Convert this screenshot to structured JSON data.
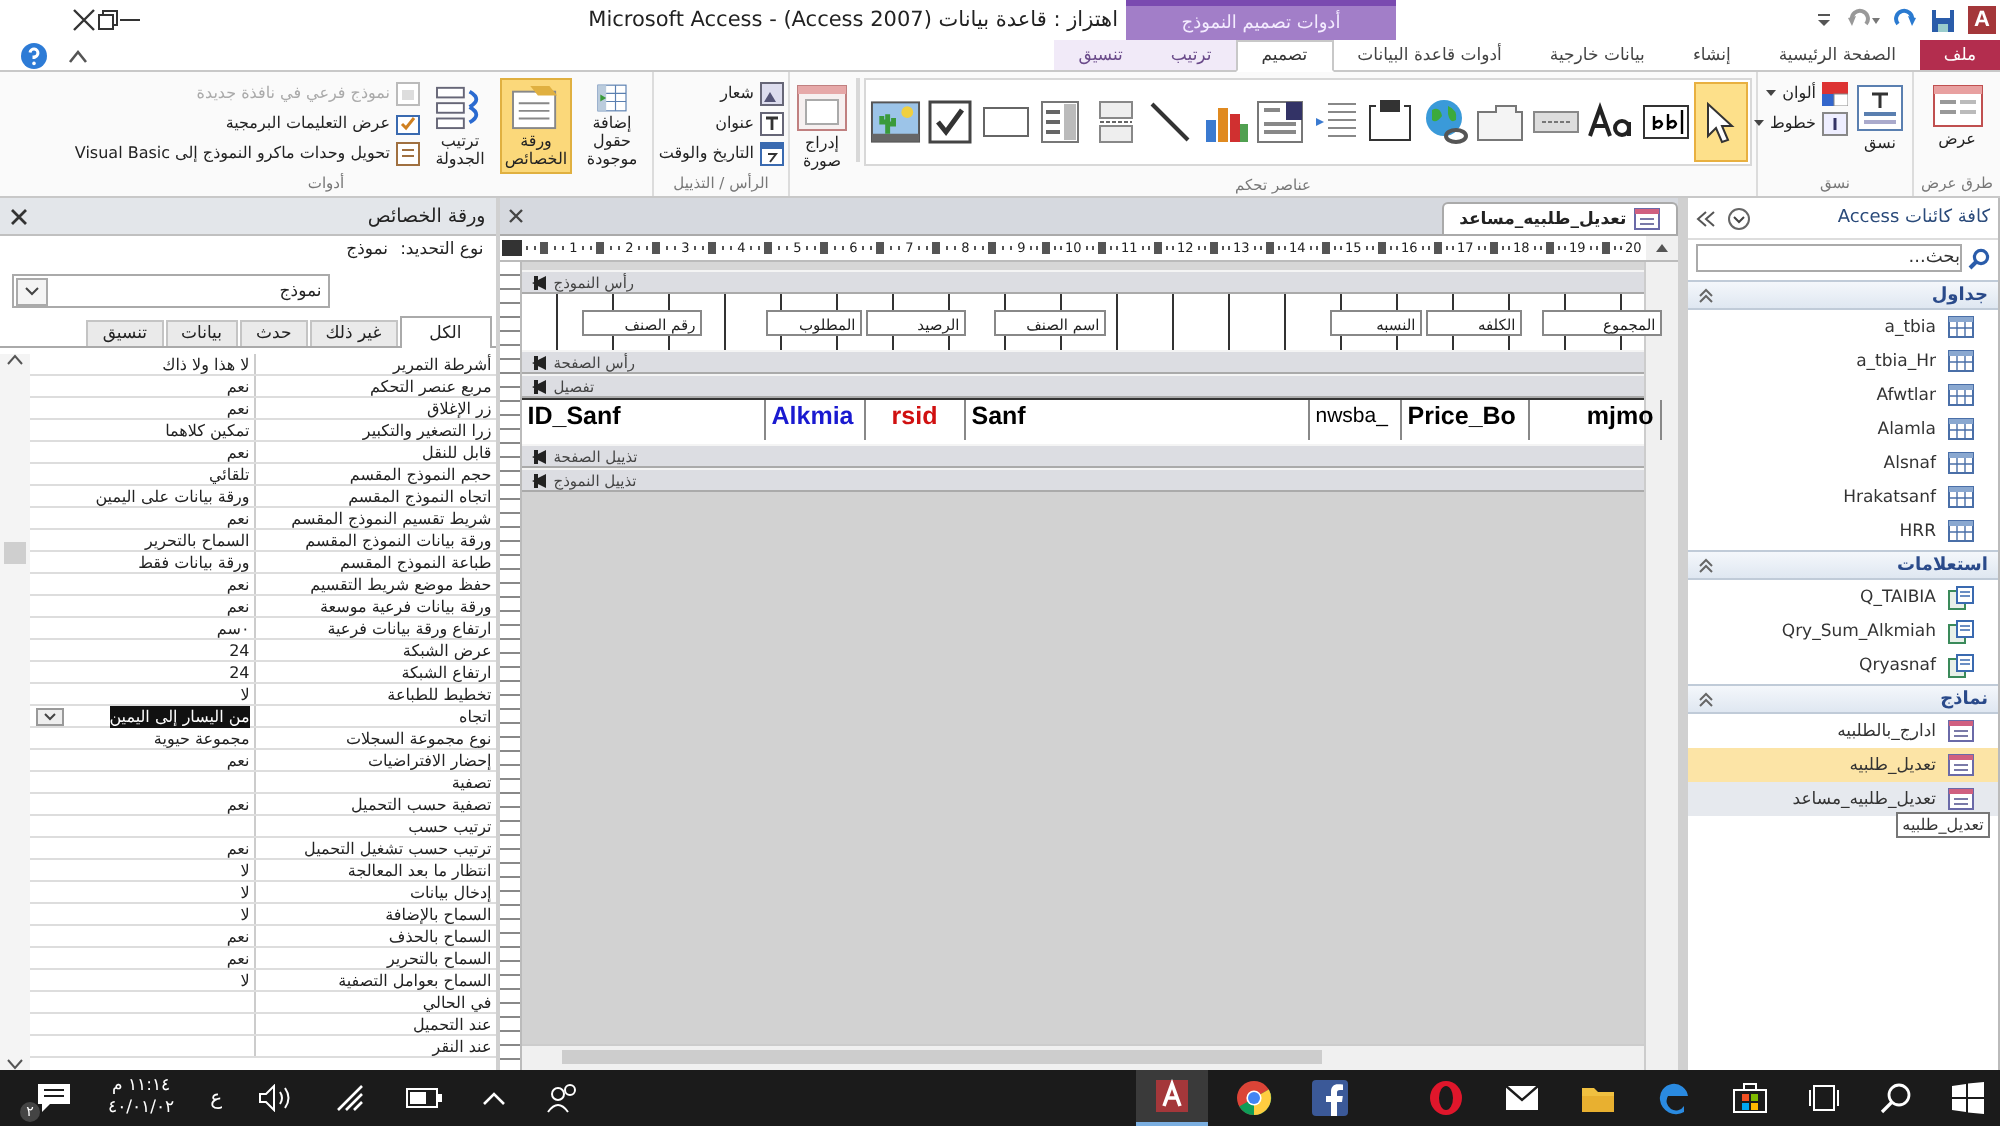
{
  "title_bar": {
    "logo": "A",
    "title": "اهتزاز : قاعدة بيانات (Access 2007) - Microsoft Access",
    "context_group": "أدوات تصميم النموذج"
  },
  "ribbon_tabs": [
    {
      "label": "ملف",
      "kind": "file",
      "selected": false
    },
    {
      "label": "الصفحة الرئيسية",
      "kind": "normal",
      "selected": false
    },
    {
      "label": "إنشاء",
      "kind": "normal",
      "selected": false
    },
    {
      "label": "بيانات خارجية",
      "kind": "normal",
      "selected": false
    },
    {
      "label": "أدوات قاعدة البيانات",
      "kind": "normal",
      "selected": false
    },
    {
      "label": "تصميم",
      "kind": "contextual",
      "selected": true
    },
    {
      "label": "ترتيب",
      "kind": "contextual",
      "selected": false
    },
    {
      "label": "تنسيق",
      "kind": "contextual",
      "selected": false
    }
  ],
  "views_group": {
    "label": "طرق عرض",
    "view_button": "عرض"
  },
  "themes_group": {
    "label": "نسق",
    "themes_button": "نسق",
    "colors_button": "ألوان",
    "fonts_button": "خطوط"
  },
  "controls_group": {
    "label": "عناصر تحكم",
    "insert_image": "إدراج صورة",
    "tools": [
      {
        "kind": "pointer",
        "selected": true
      },
      {
        "kind": "textbox",
        "selected": false
      },
      {
        "kind": "label",
        "selected": false
      },
      {
        "kind": "button",
        "selected": false
      },
      {
        "kind": "tab",
        "selected": false
      },
      {
        "kind": "hyperlink",
        "selected": false
      },
      {
        "kind": "frame",
        "selected": false
      },
      {
        "kind": "navigation",
        "selected": false
      },
      {
        "kind": "combo",
        "selected": false
      },
      {
        "kind": "chart",
        "selected": false
      },
      {
        "kind": "line",
        "selected": false
      },
      {
        "kind": "toggle",
        "selected": false
      },
      {
        "kind": "listbox",
        "selected": false
      },
      {
        "kind": "rectangle",
        "selected": false
      },
      {
        "kind": "checkbox",
        "selected": false
      },
      {
        "kind": "image",
        "selected": false
      }
    ]
  },
  "header_footer_group": {
    "label": "الرأس / التذييل",
    "items": [
      "شعار",
      "عنوان",
      "التاريخ والوقت"
    ]
  },
  "tools_group": {
    "label": "أدوات",
    "large_buttons": [
      {
        "label": "إضافة حقول موجودة",
        "selected": false
      },
      {
        "label": "ورقة الخصائص",
        "selected": true
      },
      {
        "label": "ترتيب الجدولة",
        "selected": false
      }
    ],
    "small_buttons": [
      {
        "label": "نموذج فرعي في نافذة جديدة",
        "disabled": true
      },
      {
        "label": "عرض التعليمات البرمجية",
        "disabled": false
      },
      {
        "label": "تحويل وحدات ماكرو النموذج إلى Visual Basic",
        "disabled": false
      }
    ]
  },
  "property_sheet": {
    "title": "ورقة الخصائص",
    "selection_label": "نوع التحديد:",
    "selection_type": "نموذج",
    "object_dropdown": "نموذج",
    "tabs": [
      {
        "label": "الكل",
        "selected": true
      },
      {
        "label": "غير ذلك",
        "selected": false
      },
      {
        "label": "حدث",
        "selected": false
      },
      {
        "label": "بيانات",
        "selected": false
      },
      {
        "label": "تنسيق",
        "selected": false
      }
    ],
    "rows": [
      {
        "name": "أشرطة التمرير",
        "value": "لا هذا ولا ذاك",
        "selected": false
      },
      {
        "name": "مربع عنصر التحكم",
        "value": "نعم",
        "selected": false
      },
      {
        "name": "زر الإغلاق",
        "value": "نعم",
        "selected": false
      },
      {
        "name": "زرا التصغير والتكبير",
        "value": "تمكين كلاهما",
        "selected": false
      },
      {
        "name": "قابل للنقل",
        "value": "نعم",
        "selected": false
      },
      {
        "name": "حجم النموذج المقسم",
        "value": "تلقائي",
        "selected": false
      },
      {
        "name": "اتجاه النموذج المقسم",
        "value": "ورقة بيانات على اليمين",
        "selected": false
      },
      {
        "name": "شريط تقسيم النموذج المقسم",
        "value": "نعم",
        "selected": false
      },
      {
        "name": "ورقة بيانات النموذج المقسم",
        "value": "السماح بالتحرير",
        "selected": false
      },
      {
        "name": "طباعة النموذج المقسم",
        "value": "ورقة بيانات فقط",
        "selected": false
      },
      {
        "name": "حفظ موضع شريط التقسيم",
        "value": "نعم",
        "selected": false
      },
      {
        "name": "ورقة بيانات فرعية موسعة",
        "value": "نعم",
        "selected": false
      },
      {
        "name": "ارتفاع ورقة بيانات فرعية",
        "value": "٠سم",
        "selected": false
      },
      {
        "name": "عرض الشبكة",
        "value": "24",
        "selected": false
      },
      {
        "name": "ارتفاع الشبكة",
        "value": "24",
        "selected": false
      },
      {
        "name": "تخطيط للطباعة",
        "value": "لا",
        "selected": false
      },
      {
        "name": "اتجاه",
        "value": "من اليسار إلى اليمين",
        "selected": true
      },
      {
        "name": "نوع مجموعة السجلات",
        "value": "مجموعة حيوية",
        "selected": false
      },
      {
        "name": "إحضار الافتراضيات",
        "value": "نعم",
        "selected": false
      },
      {
        "name": "تصفية",
        "selected": false
      },
      {
        "name": "تصفية حسب التحميل",
        "value": "نعم",
        "selected": false
      },
      {
        "name": "ترتيب حسب",
        "selected": false
      },
      {
        "name": "ترتيب حسب تشغيل التحميل",
        "value": "نعم",
        "selected": false
      },
      {
        "name": "انتظار ما بعد المعالجة",
        "value": "لا",
        "selected": false
      },
      {
        "name": "إدخال بيانات",
        "value": "لا",
        "selected": false
      },
      {
        "name": "السماح بالإضافة",
        "value": "لا",
        "selected": false
      },
      {
        "name": "السماح بالحذف",
        "value": "نعم",
        "selected": false
      },
      {
        "name": "السماح بالتحرير",
        "value": "نعم",
        "selected": false
      },
      {
        "name": "السماح بعوامل التصفية",
        "value": "لا",
        "selected": false
      },
      {
        "name": "في الحالي",
        "selected": false
      },
      {
        "name": "عند التحميل",
        "selected": false
      },
      {
        "name": "عند النقر",
        "selected": false
      }
    ]
  },
  "designer": {
    "document_tab": "تعديل_طلبيه_مساعد",
    "ruler_marks": [
      "20",
      "19",
      "18",
      "17",
      "16",
      "15",
      "14",
      "13",
      "12",
      "11",
      "10",
      "9",
      "8",
      "7",
      "6",
      "5",
      "4",
      "3",
      "2",
      "1"
    ],
    "sections": [
      {
        "title": "رأس النموذج",
        "kind": "form_header"
      },
      {
        "title": "رأس الصفحة",
        "kind": "empty"
      },
      {
        "title": "تفصيل",
        "kind": "detail"
      },
      {
        "title": "تذييل الصفحة",
        "kind": "empty"
      },
      {
        "title": "تذييل النموذج",
        "kind": "empty"
      }
    ],
    "header_labels": [
      "المجموع",
      "الكلفه",
      "النسبه",
      "اسم الصنف",
      "الرصيد",
      "المطلوب",
      "رقم الصنف"
    ],
    "detail_fields": [
      {
        "text": "mjmo",
        "color": "#000000"
      },
      {
        "text": "Price_Bo",
        "color": "#000000"
      },
      {
        "text": "nwsba_",
        "color": "#000000"
      },
      {
        "text": "Sanf",
        "color": "#000000"
      },
      {
        "text": "rsid",
        "color": "#d01010"
      },
      {
        "text": "Alkmia",
        "color": "#1a1ad0"
      },
      {
        "text": "ID_Sanf",
        "color": "#000000"
      }
    ]
  },
  "navigation_pane": {
    "title": "كافة كائنات Access",
    "search": {
      "placeholder": "بحث..."
    },
    "groups": [
      {
        "title": "جداول",
        "kind": "table",
        "expanded": true,
        "items": [
          {
            "label": "a_tbia",
            "selected": false,
            "hovered": false
          },
          {
            "label": "a_tbia_Hr",
            "selected": false,
            "hovered": false
          },
          {
            "label": "Afwtlar",
            "selected": false,
            "hovered": false
          },
          {
            "label": "Alamla",
            "selected": false,
            "hovered": false
          },
          {
            "label": "Alsnaf",
            "selected": false,
            "hovered": false
          },
          {
            "label": "Hrakatsanf",
            "selected": false,
            "hovered": false
          },
          {
            "label": "HRR",
            "selected": false,
            "hovered": false
          }
        ]
      },
      {
        "title": "استعلامات",
        "kind": "query",
        "expanded": true,
        "items": [
          {
            "label": "Q_TAIBIA",
            "selected": false,
            "hovered": false
          },
          {
            "label": "Qry_Sum_Alkmiah",
            "selected": false,
            "hovered": false
          },
          {
            "label": "Qryasnaf",
            "selected": false,
            "hovered": false
          }
        ]
      },
      {
        "title": "نماذج",
        "kind": "form",
        "expanded": true,
        "items": [
          {
            "label": "ادارج_بالطلبيه",
            "selected": false,
            "hovered": false
          },
          {
            "label": "تعديل_طلبيه",
            "selected": true,
            "hovered": false
          },
          {
            "label": "تعديل_طلبيه_مساعد",
            "selected": false,
            "hovered": true
          }
        ]
      }
    ],
    "tooltip": "تعديل_طلبيه"
  },
  "taskbar": {
    "time": "١١:١٤ م",
    "date": "٤٠/٠١/٠٢",
    "language": "ع",
    "notification_count": "٢"
  }
}
